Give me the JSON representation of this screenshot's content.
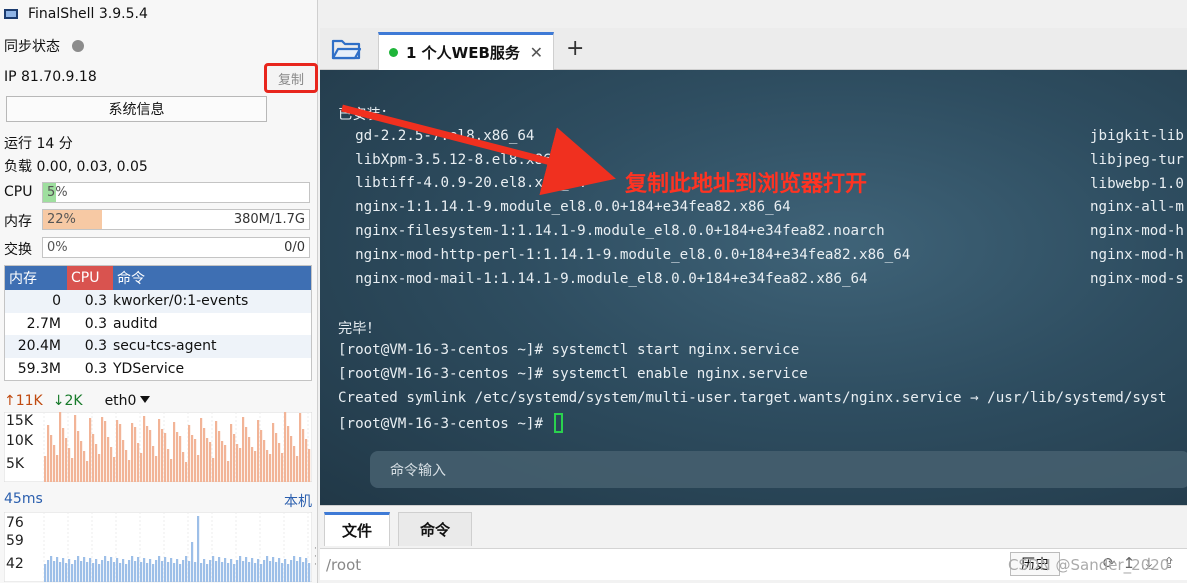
{
  "app": {
    "title": "FinalShell 3.9.5.4"
  },
  "left": {
    "sync_label": "同步状态",
    "ip_label": "IP 81.70.9.18",
    "copy_label": "复制",
    "sysinfo_label": "系统信息",
    "uptime": "运行 14 分",
    "load": "负载 0.00, 0.03, 0.05",
    "cpu": {
      "label": "CPU",
      "value": "5%",
      "percent": 5
    },
    "mem": {
      "label": "内存",
      "value": "22%",
      "percent": 22,
      "detail": "380M/1.7G"
    },
    "swap": {
      "label": "交换",
      "value": "0%",
      "percent": 0,
      "detail": "0/0"
    },
    "process_table": {
      "headers": [
        "内存",
        "CPU",
        "命令"
      ],
      "rows": [
        {
          "mem": "0",
          "cpu": "0.3",
          "cmd": "kworker/0:1-events"
        },
        {
          "mem": "2.7M",
          "cpu": "0.3",
          "cmd": "auditd"
        },
        {
          "mem": "20.4M",
          "cpu": "0.3",
          "cmd": "secu-tcs-agent"
        },
        {
          "mem": "59.3M",
          "cpu": "0.3",
          "cmd": "YDService"
        }
      ]
    },
    "network": {
      "up": "11K",
      "down": "2K",
      "interface": "eth0",
      "y_labels": [
        "15K",
        "10K",
        "5K"
      ]
    },
    "latency": {
      "current": "45ms",
      "host": "本机",
      "y_labels": [
        "76",
        "59",
        "42"
      ]
    },
    "colors": {
      "accent": "#3e6fb3",
      "cpu_head": "#d9534f",
      "cpu_bar": "#9fdf9f",
      "mem_bar": "#f7c9a4",
      "net_up": "#f2b497",
      "latency": "#9dbfe8"
    }
  },
  "tabs": [
    {
      "label": "1 个人WEB服务",
      "active": true
    }
  ],
  "terminal": {
    "lines": [
      "已安装：",
      "  gd-2.2.5-7.el8.x86_64",
      "  libXpm-3.5.12-8.el8.x86_64",
      "  libtiff-4.0.9-20.el8.x86_64",
      "  nginx-1:1.14.1-9.module_el8.0.0+184+e34fea82.x86_64",
      "  nginx-filesystem-1:1.14.1-9.module_el8.0.0+184+e34fea82.noarch",
      "  nginx-mod-http-perl-1:1.14.1-9.module_el8.0.0+184+e34fea82.x86_64",
      "  nginx-mod-mail-1:1.14.1-9.module_el8.0.0+184+e34fea82.x86_64",
      "",
      "完毕！",
      "[root@VM-16-3-centos ~]# systemctl start nginx.service",
      "[root@VM-16-3-centos ~]# systemctl enable nginx.service",
      "Created symlink /etc/systemd/system/multi-user.target.wants/nginx.service → /usr/lib/systemd/syst",
      "[root@VM-16-3-centos ~]# "
    ],
    "right_column": [
      "jbigkit-lib",
      "libjpeg-tur",
      "libwebp-1.0",
      "nginx-all-m",
      "nginx-mod-h",
      "nginx-mod-h",
      "nginx-mod-s"
    ],
    "annotation": "复制此地址到浏览器打开",
    "input_placeholder": "命令输入"
  },
  "bottom": {
    "tabs": [
      "文件",
      "命令"
    ],
    "path": "/root",
    "history_label": "历史",
    "watermark": "CSDN @Sander_2020"
  }
}
